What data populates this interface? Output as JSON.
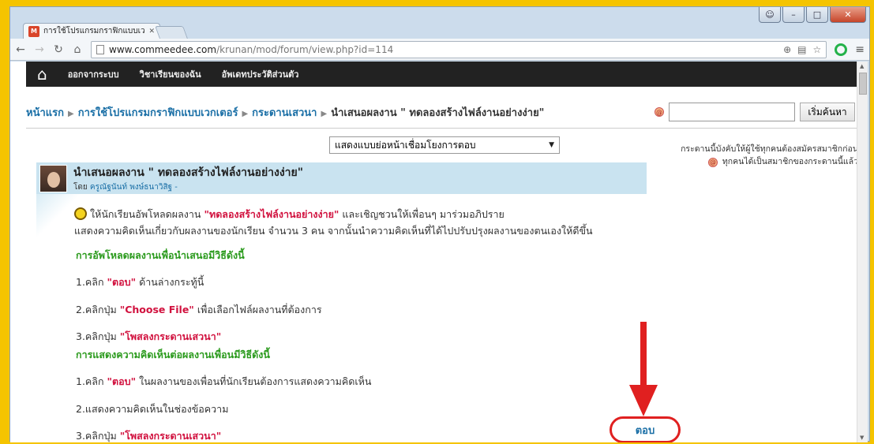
{
  "browser": {
    "tab_title": "การใช้โปรแกรมกราฟิกแบบเว",
    "url_host": "www.commeedee.com",
    "url_path": "/krunan/mod/forum/view.php?id=114"
  },
  "site_nav": {
    "links": [
      "ออกจากระบบ",
      "วิชาเรียนของฉัน",
      "อัพเดทประวัติส่วนตัว"
    ]
  },
  "breadcrumb": {
    "items": [
      "หน้าแรก",
      "การใช้โปรแกรมกราฟิกแบบเวกเตอร์",
      "กระดานเสวนา"
    ],
    "current": "นำเสนอผลงาน \" ทดลองสร้างไฟล์งานอย่างง่าย\""
  },
  "search": {
    "value": "",
    "button_label": "เริ่มค้นหา"
  },
  "display_mode": {
    "selected": "แสดงแบบย่อหน้าเชื่อมโยงการตอบ"
  },
  "subscription": {
    "line1": "กระดานนี้บังคับให้ผู้ใช้ทุกคนต้องสมัครสมาชิกก่อน",
    "line2": "ทุกคนได้เป็นสมาชิกของกระดานนี้แล้ว"
  },
  "post": {
    "subject": "นำเสนอผลงาน \" ทดลองสร้างไฟล์งานอย่างง่าย\"",
    "by_prefix": "โดย",
    "author": "ครูณัฐนันท์ พงษ์ธนาวิสิฐ",
    "author_suffix": "-",
    "intro_a": "ให้นักเรียนอัพโหลดผลงาน",
    "intro_highlight": "\"ทดลองสร้างไฟล์งานอย่างง่าย\"",
    "intro_b": "และเชิญชวนให้เพื่อนๆ มาร่วมอภิปราย",
    "intro_line2": "แสดงความคิดเห็นเกี่ยวกับผลงานของนักเรียน จำนวน  3 คน จากนั้นนำความคิดเห็นที่ได้ไปปรับปรุงผลงานของตนเองให้ดีขึ้น",
    "upload_heading": "การอัพโหลดผลงานเพื่อนำเสนอมีวิธีดังนี้",
    "u1_a": "1.คลิก",
    "u1_hl": "\"ตอบ\"",
    "u1_b": "ด้านล่างกระทู้นี้",
    "u2_a": "2.คลิกปุ่ม",
    "u2_hl": "\"Choose File\"",
    "u2_b": "เพื่อเลือกไฟล์ผลงานที่ต้องการ",
    "u3_a": "3.คลิกปุ่ม",
    "u3_hl": "\"โพสลงกระดานเสวนา\"",
    "comment_heading": "การแสดงความคิดเห็นต่อผลงานเพื่อนมีวิธีดังนี้",
    "c1_a": "1.คลิก",
    "c1_hl": "\"ตอบ\"",
    "c1_b": "ในผลงานของเพื่อนที่นักเรียนต้องการแสดงความคิดเห็น",
    "c2": "2.แสดงความคิดเห็นในช่องข้อความ",
    "c3_a": "3.คลิกปุ่ม",
    "c3_hl": "\"โพสลงกระดานเสวนา\"",
    "reply_label": "ตอบ"
  },
  "colors": {
    "highlight_red": "#d1113e",
    "heading_green": "#2a9a1c",
    "annotation_red": "#e02020"
  }
}
